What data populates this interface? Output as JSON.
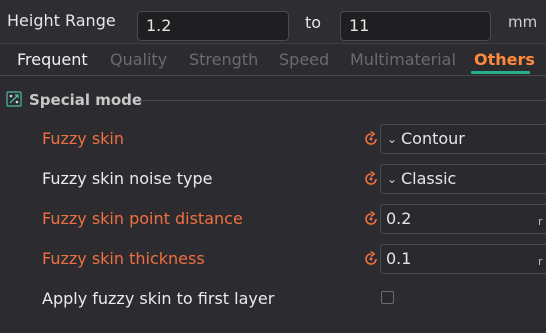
{
  "height_range": {
    "label": "Height Range",
    "from_value": "1.2",
    "to_label": "to",
    "to_value": "11",
    "unit": "mm"
  },
  "tabs": [
    {
      "label": "Frequent",
      "state": "selected"
    },
    {
      "label": "Quality",
      "state": "disabled"
    },
    {
      "label": "Strength",
      "state": "disabled"
    },
    {
      "label": "Speed",
      "state": "disabled"
    },
    {
      "label": "Multimaterial",
      "state": "disabled"
    },
    {
      "label": "Others",
      "state": "active"
    }
  ],
  "section": {
    "icon": "special-mode-icon",
    "title": "Special mode"
  },
  "settings": [
    {
      "label": "Fuzzy skin",
      "modified": true,
      "control": "dropdown",
      "value": "Contour",
      "reset_icon": "reset-icon"
    },
    {
      "label": "Fuzzy skin noise type",
      "modified": false,
      "control": "dropdown",
      "value": "Classic",
      "reset_icon": "reset-icon"
    },
    {
      "label": "Fuzzy skin point distance",
      "modified": true,
      "control": "number",
      "value": "0.2",
      "unit_peek": "r",
      "reset_icon": "reset-icon"
    },
    {
      "label": "Fuzzy skin thickness",
      "modified": true,
      "control": "number",
      "value": "0.1",
      "unit_peek": "r",
      "reset_icon": "reset-icon"
    },
    {
      "label": "Apply fuzzy skin to first layer",
      "modified": false,
      "control": "checkbox",
      "checked": false
    }
  ],
  "colors": {
    "background": "#2c2c30",
    "modified_label": "#f16f3f",
    "active_tab": "#ff8a3d",
    "tab_underline": "#23b08a"
  }
}
